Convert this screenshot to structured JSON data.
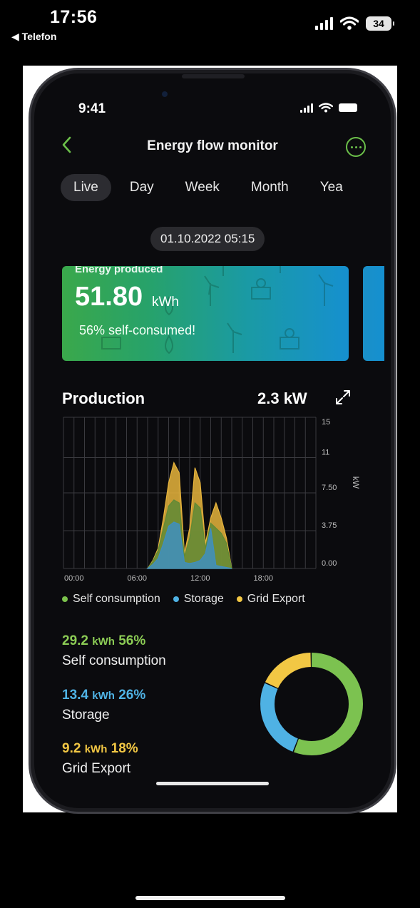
{
  "device": {
    "time": "17:56",
    "back_label": "◀ Telefon",
    "battery": "34"
  },
  "phone": {
    "time": "9:41"
  },
  "app": {
    "title": "Energy flow monitor",
    "tabs": [
      "Live",
      "Day",
      "Week",
      "Month",
      "Yea"
    ],
    "active_tab": "Live",
    "date": "01.10.2022 05:15"
  },
  "card": {
    "label": "Energy produced",
    "value": "51.80",
    "unit": "kWh",
    "subtitle": "56% self-consumed!"
  },
  "production": {
    "title": "Production",
    "value": "2.3  kW"
  },
  "chart_data": {
    "type": "area",
    "x_ticks": [
      "00:00",
      "06:00",
      "12:00",
      "18:00"
    ],
    "y_ticks": [
      "15",
      "11",
      "7.50",
      "3.75",
      "0.00"
    ],
    "ylabel": "kW",
    "ylim": [
      0,
      15
    ],
    "xlim": [
      0,
      24
    ],
    "x": [
      8,
      8.5,
      9,
      9.5,
      10,
      10.5,
      11,
      11.5,
      12,
      12.5,
      13,
      13.5,
      14,
      14.5,
      15,
      15.5,
      16
    ],
    "series": [
      {
        "name": "Grid Export",
        "color": "#e8b53c",
        "values": [
          0,
          0.8,
          2.0,
          5.0,
          8.5,
          10.5,
          9.5,
          1.5,
          4.0,
          10.0,
          8.5,
          2.5,
          5.0,
          6.5,
          5.0,
          3.0,
          0
        ]
      },
      {
        "name": "Self consumption",
        "color": "#5f8a35",
        "values": [
          0,
          0.7,
          1.8,
          4.0,
          6.2,
          6.8,
          6.5,
          1.2,
          3.0,
          6.5,
          6.0,
          2.0,
          4.5,
          4.0,
          3.5,
          2.5,
          0
        ]
      },
      {
        "name": "Storage",
        "color": "#3f8fc0",
        "values": [
          0,
          0.4,
          1.0,
          2.5,
          4.2,
          4.6,
          4.4,
          0.6,
          0.5,
          0.6,
          0.8,
          1.5,
          4.0,
          0.3,
          0.2,
          0.1,
          0
        ]
      }
    ]
  },
  "legend": [
    {
      "label": "Self consumption",
      "color": "#7bc24c"
    },
    {
      "label": "Storage",
      "color": "#4fb2e4"
    },
    {
      "label": "Grid Export",
      "color": "#f2c744"
    }
  ],
  "stats": {
    "self": {
      "kwh": "29.2",
      "unit": "kWh",
      "pct": "56%",
      "label": "Self consumption"
    },
    "storage": {
      "kwh": "13.4",
      "unit": "kWh",
      "pct": "26%",
      "label": "Storage"
    },
    "grid": {
      "kwh": "9.2",
      "unit": "kWh",
      "pct": "18%",
      "label": "Grid Export"
    }
  },
  "donut": {
    "segments": [
      {
        "name": "Self consumption",
        "percent": 56,
        "color": "#7cc250"
      },
      {
        "name": "Storage",
        "percent": 26,
        "color": "#4fb2e4"
      },
      {
        "name": "Grid Export",
        "percent": 18,
        "color": "#f2c744"
      }
    ]
  },
  "colors": {
    "accent": "#6cc04a",
    "background": "#0b0b0e"
  }
}
